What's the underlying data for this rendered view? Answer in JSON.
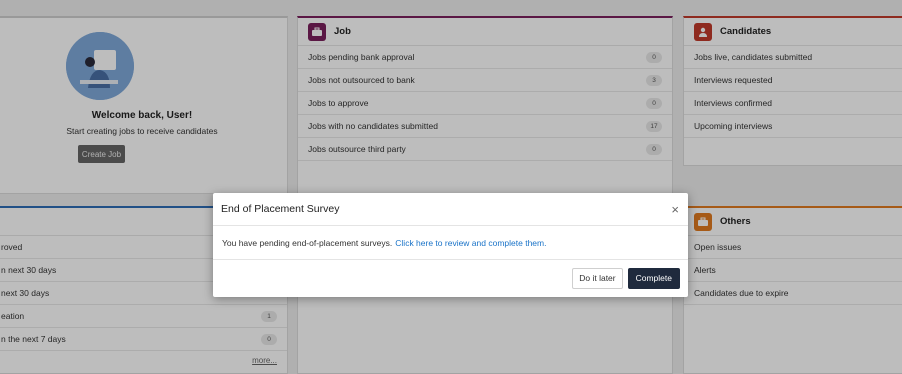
{
  "welcome": {
    "title": "Welcome back, User!",
    "subtitle": "Start creating jobs to receive candidates",
    "create_button": "Create Job"
  },
  "job_panel": {
    "title": "Job",
    "accent": "#7a1f5c",
    "rows": [
      {
        "label": "Jobs pending bank approval",
        "count": "0"
      },
      {
        "label": "Jobs not outsourced to bank",
        "count": "3"
      },
      {
        "label": "Jobs to approve",
        "count": "0"
      },
      {
        "label": "Jobs with no candidates submitted",
        "count": "17"
      },
      {
        "label": "Jobs outsource third party",
        "count": "0"
      }
    ]
  },
  "candidates_panel": {
    "title": "Candidates",
    "accent": "#c0392b",
    "rows": [
      {
        "label": "Jobs live, candidates submitted"
      },
      {
        "label": "Interviews requested"
      },
      {
        "label": "Interviews confirmed"
      },
      {
        "label": "Upcoming interviews"
      }
    ]
  },
  "alerts_panel": {
    "accent": "#2d6cb5",
    "rows": [
      {
        "label": "roved",
        "count": ""
      },
      {
        "label": "n next 30 days",
        "count": ""
      },
      {
        "label": "next 30 days",
        "count": ""
      },
      {
        "label": "eation",
        "count": "1"
      },
      {
        "label": "n the next 7 days",
        "count": "0"
      }
    ],
    "more_link": "more..."
  },
  "others_panel": {
    "title": "Others",
    "accent": "#e07a1f",
    "rows": [
      {
        "label": "Open issues"
      },
      {
        "label": "Alerts"
      },
      {
        "label": "Candidates due to expire"
      }
    ]
  },
  "modal": {
    "title": "End of Placement Survey",
    "close_symbol": "×",
    "body_text": "You have pending end-of-placement surveys.",
    "body_link": "Click here to review and complete them.",
    "later_button": "Do it later",
    "complete_button": "Complete"
  }
}
